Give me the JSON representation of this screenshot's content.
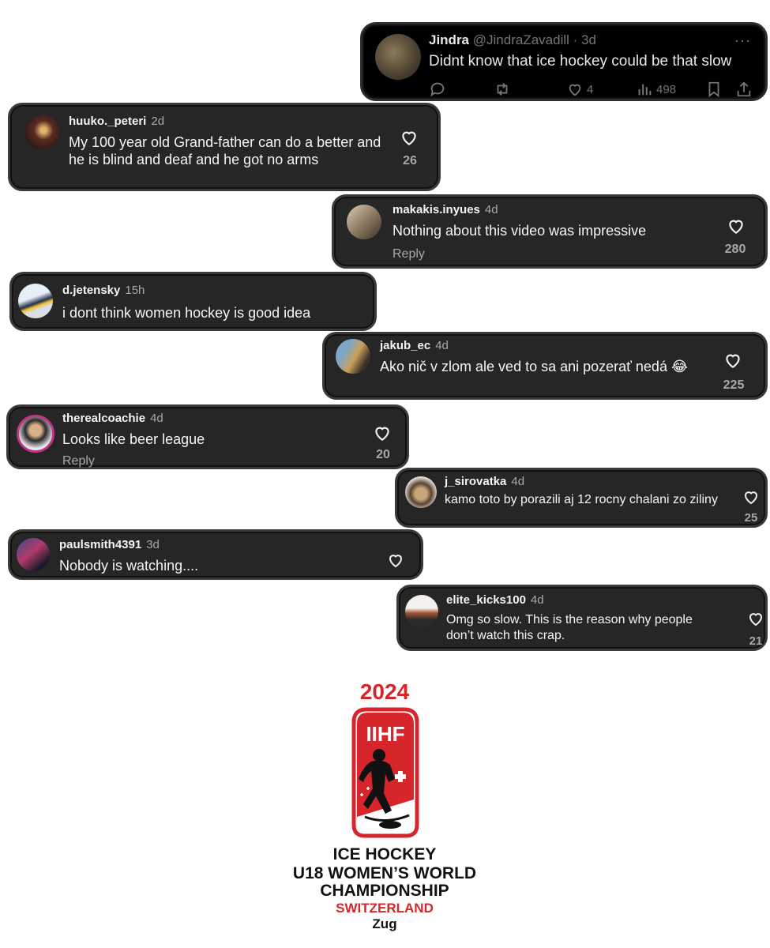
{
  "x_post": {
    "name": "Jindra",
    "handle": "@JindraZavadill",
    "age": "3d",
    "more": "···",
    "text": "Didnt know that ice hockey could be that slow",
    "likes": "4",
    "views": "498"
  },
  "comments": [
    {
      "user": "huuko._peteri",
      "age": "2d",
      "text": "My 100 year old Grand-father can do a better and he is blind and deaf and he got no arms",
      "likes": "26"
    },
    {
      "user": "makakis.inyues",
      "age": "4d",
      "text": "Nothing about this video was impressive",
      "reply": "Reply",
      "likes": "280"
    },
    {
      "user": "d.jetensky",
      "age": "15h",
      "text": "i dont think women hockey is good idea"
    },
    {
      "user": "jakub_ec",
      "age": "4d",
      "text": "Ako nič v zlom ale ved to sa ani pozerať nedá 😂",
      "likes": "225"
    },
    {
      "user": "therealcoachie",
      "age": "4d",
      "text": "Looks like beer league",
      "reply": "Reply",
      "likes": "20"
    },
    {
      "user": "j_sirovatka",
      "age": "4d",
      "text": "kamo toto by porazili aj 12 rocny chalani zo ziliny",
      "likes": "25"
    },
    {
      "user": "paulsmith4391",
      "age": "3d",
      "text": "Nobody is watching...."
    },
    {
      "user": "elite_kicks100",
      "age": "4d",
      "text": "Omg so slow. This is the reason why people don’t watch this crap.",
      "likes": "21"
    }
  ],
  "logo": {
    "year": "2024",
    "org": "IIHF",
    "line1": "ICE HOCKEY",
    "line2": "U18 WOMEN’S WORLD",
    "line3": "CHAMPIONSHIP",
    "country": "SWITZERLAND",
    "city": "Zug",
    "red": "#d6252b"
  }
}
